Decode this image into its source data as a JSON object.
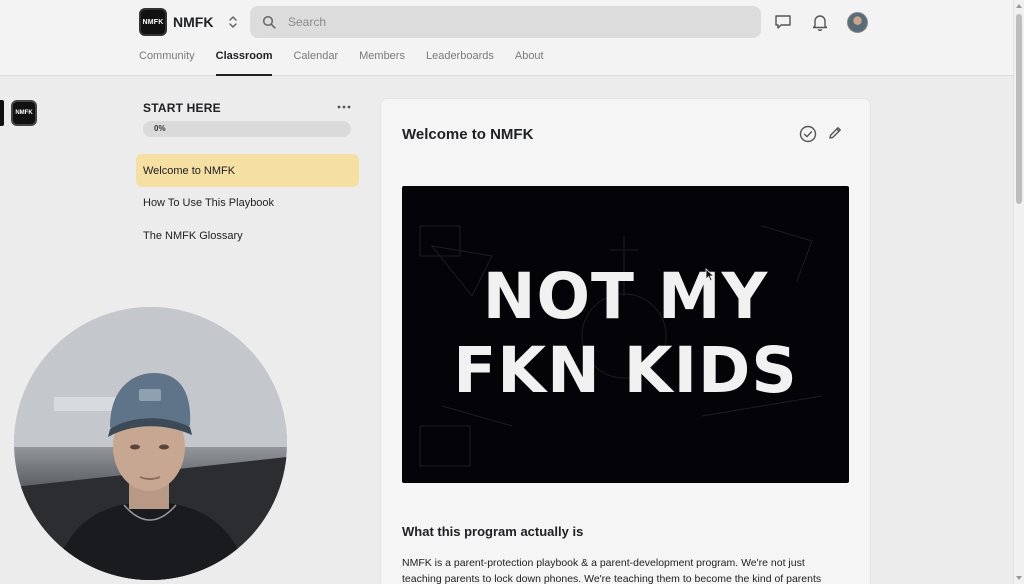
{
  "header": {
    "brand_logo_text": "NMFK",
    "brand_name": "NMFK",
    "search_placeholder": "Search"
  },
  "nav": {
    "tabs": [
      {
        "label": "Community",
        "active": false
      },
      {
        "label": "Classroom",
        "active": true
      },
      {
        "label": "Calendar",
        "active": false
      },
      {
        "label": "Members",
        "active": false
      },
      {
        "label": "Leaderboards",
        "active": false
      },
      {
        "label": "About",
        "active": false
      }
    ]
  },
  "sidebar": {
    "logo_text": "NMFK",
    "course_title": "START HERE",
    "progress_label": "0%",
    "progress_value": 0,
    "lessons": [
      {
        "label": "Welcome to NMFK",
        "active": true
      },
      {
        "label": "How To Use This Playbook",
        "active": false
      },
      {
        "label": "The NMFK Glossary",
        "active": false
      }
    ]
  },
  "content": {
    "title": "Welcome to NMFK",
    "video": {
      "line1": "NOT MY",
      "line2": "FKN KIDS"
    },
    "section_heading": "What this program actually is",
    "body": "NMFK is a parent-protection playbook & a parent-development program. We're not just teaching parents to lock down phones. We're teaching them to become the kind of parents"
  },
  "colors": {
    "accent_active_lesson": "#f6dfa3",
    "video_background": "#040408",
    "text_primary": "#202124"
  },
  "icons": {
    "search": "search-icon",
    "chat": "chat-icon",
    "bell": "bell-icon",
    "switch": "chevron-up-down-icon",
    "more": "more-horizontal-icon",
    "check": "check-circle-icon",
    "edit": "pencil-icon"
  }
}
